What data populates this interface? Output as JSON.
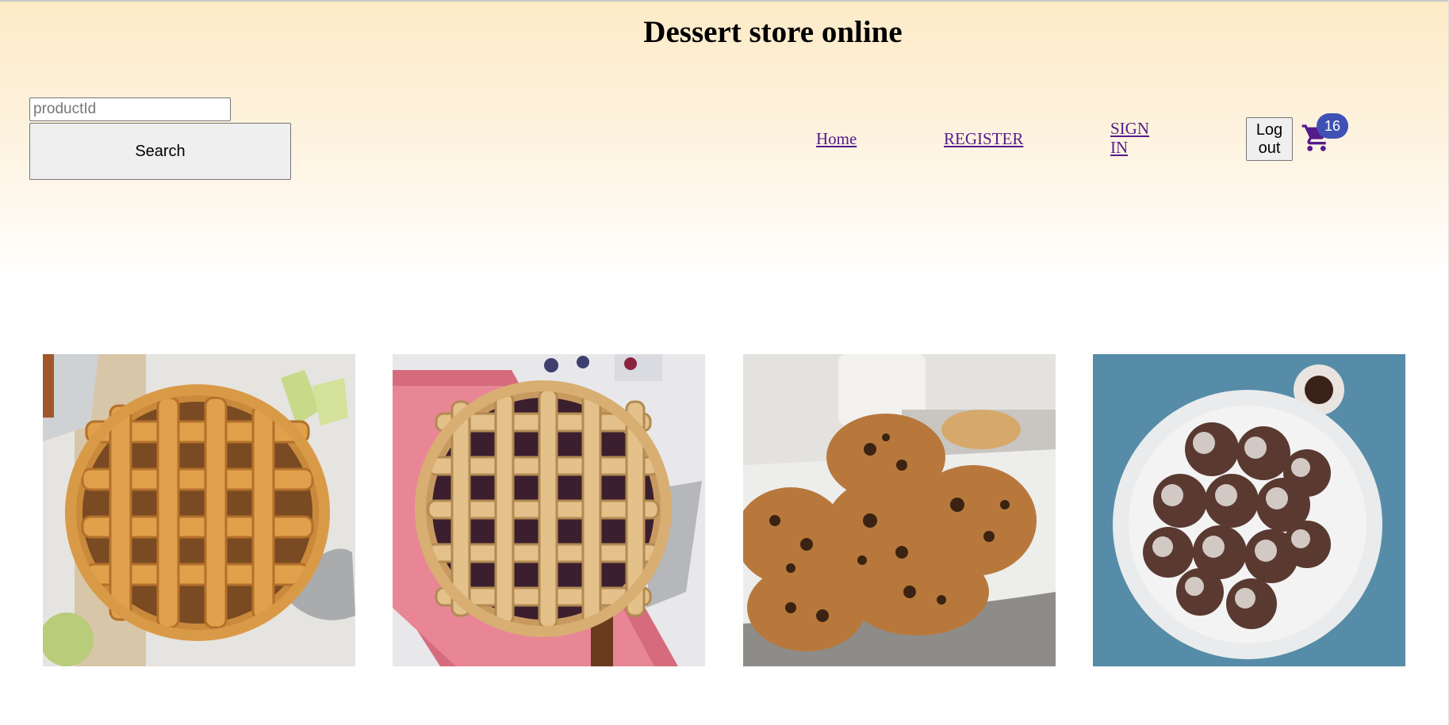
{
  "header": {
    "title": "Dessert store online"
  },
  "search": {
    "placeholder": "productId",
    "value": "",
    "button_label": "Search"
  },
  "nav": {
    "home": "Home",
    "register": "REGISTER",
    "signin_line1": "SIGN",
    "signin_line2": "IN",
    "logout_line1": "Log",
    "logout_line2": "out"
  },
  "cart": {
    "icon": "cart-icon",
    "count": "16"
  },
  "colors": {
    "header_gradient_top": "#fdebc7",
    "link": "#551a8b",
    "badge": "#3f51b5",
    "cart_icon": "#551a8b"
  },
  "products": [
    {
      "image": "apple-lattice-pie"
    },
    {
      "image": "berry-lattice-pie"
    },
    {
      "image": "chocolate-chip-cookies"
    },
    {
      "image": "coconut-chocolate-balls"
    }
  ]
}
